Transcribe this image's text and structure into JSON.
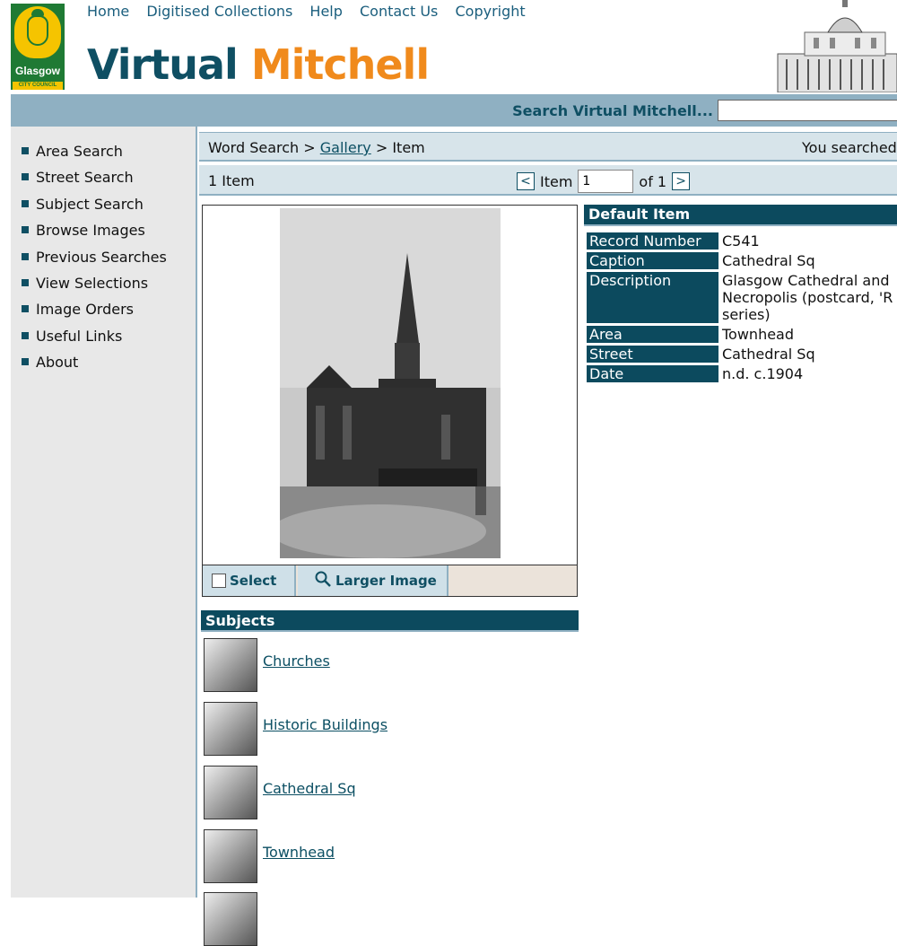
{
  "logo": {
    "line1": "Glasgow",
    "line2": "CITY COUNCIL"
  },
  "nav": {
    "home": "Home",
    "collections": "Digitised Collections",
    "help": "Help",
    "contact": "Contact Us",
    "copyright": "Copyright"
  },
  "brand": {
    "part1": "Virtual",
    "part2": "Mitchell"
  },
  "search": {
    "label": "Search Virtual Mitchell...",
    "value": ""
  },
  "sidebar": {
    "items": [
      {
        "label": "Area Search"
      },
      {
        "label": "Street Search"
      },
      {
        "label": "Subject Search"
      },
      {
        "label": "Browse Images"
      },
      {
        "label": "Previous Searches"
      },
      {
        "label": "View Selections"
      },
      {
        "label": "Image Orders"
      },
      {
        "label": "Useful Links"
      },
      {
        "label": "About"
      }
    ]
  },
  "breadcrumb": {
    "word_search": "Word Search",
    "sep1": " > ",
    "gallery": "Gallery",
    "sep2": " > ",
    "item": "Item",
    "right": "You searched"
  },
  "pager": {
    "count": "1 Item",
    "prev": "<",
    "item_label": "Item",
    "item_value": "1",
    "of": "of 1",
    "next": ">"
  },
  "buttons": {
    "select": "Select",
    "larger": "Larger Image"
  },
  "subjects": {
    "heading": "Subjects",
    "items": [
      {
        "label": "Churches"
      },
      {
        "label": "Historic Buildings"
      },
      {
        "label": "Cathedral Sq"
      },
      {
        "label": "Townhead"
      }
    ]
  },
  "details": {
    "heading": "Default Item",
    "rows": [
      {
        "key": "Record Number",
        "value": "C541"
      },
      {
        "key": "Caption",
        "value": "Cathedral Sq"
      },
      {
        "key": "Description",
        "value": "Glasgow Cathedral and\nNecropolis (postcard, 'R\nseries)"
      },
      {
        "key": "Area",
        "value": "Townhead"
      },
      {
        "key": "Street",
        "value": "Cathedral Sq"
      },
      {
        "key": "Date",
        "value": "n.d. c.1904"
      }
    ]
  },
  "colors": {
    "teal_dark": "#0c4a5e",
    "orange": "#f08a1c",
    "bar_blue": "#8fb0c2",
    "light_blue": "#d7e4ea"
  }
}
